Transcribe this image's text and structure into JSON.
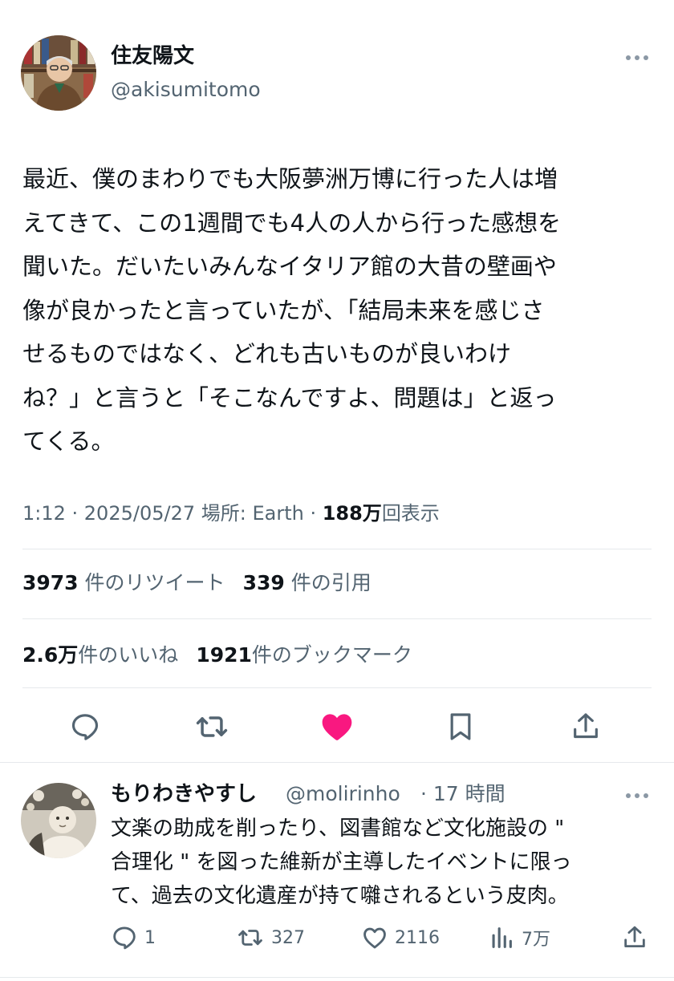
{
  "tweet": {
    "author_name": "住友陽文",
    "author_handle": "@akisumitomo",
    "text_lines": [
      "最近、僕のまわりでも大阪夢洲万博に行った人は増",
      "えてきて、この1週間でも4人の人から行った感想を",
      "聞いた。だいたいみんなイタリア館の大昔の壁画や",
      "像が良かったと言っていたが、「結局未来を感じさ",
      "せるものではなく、どれも古いものが良いわけ",
      "ね？」と言うと「そこなんですよ、問題は」と返っ",
      "てくる。"
    ],
    "meta_time": "1:12 · 2025/05/27 場所: Earth · ",
    "views_count": "188万",
    "views_label": "回表示"
  },
  "stats": {
    "retweets_count": "3973",
    "retweets_label": "件のリツイート",
    "quotes_count": "339",
    "quotes_label": "件の引用",
    "likes_count": "2.6万",
    "likes_label": "件のいいね",
    "bookmarks_count": "1921",
    "bookmarks_label": "件のブックマーク"
  },
  "actions": {
    "icons": [
      "reply-icon",
      "retweet-icon",
      "like-icon",
      "bookmark-icon",
      "share-icon"
    ],
    "like_color": "#f91880"
  },
  "reply": {
    "author_name": "もりわきやすし",
    "author_handle": "@molirinho",
    "time": "· 17 時間",
    "text_lines": [
      "文楽の助成を削ったり、図書館など文化施設の \"",
      "合理化 \" を図った維新が主導したイベントに限っ",
      "て、過去の文化遺産が持て囃されるという皮肉。"
    ],
    "reply_count": "1",
    "retweet_count": "327",
    "like_count": "2116",
    "views_count": "7万"
  },
  "colors": {
    "text_primary": "#0f1419",
    "text_secondary": "#536471",
    "divider": "#e6e9ec",
    "like_pink": "#f91880"
  }
}
